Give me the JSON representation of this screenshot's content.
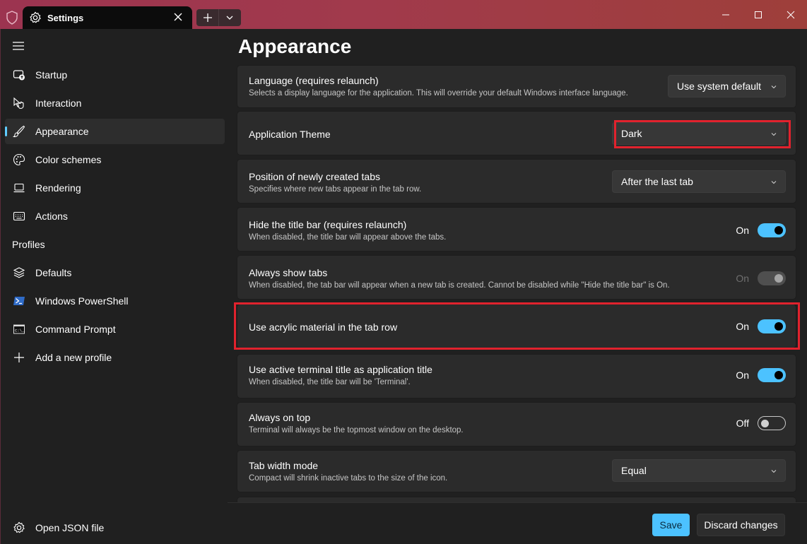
{
  "titlebar": {
    "tab_label": "Settings",
    "tab_icon": "gear-icon",
    "new_tab_icon": "plus-icon",
    "tab_menu_icon": "chevron-down-icon",
    "window_controls": [
      "minimize",
      "maximize",
      "close"
    ],
    "accent_color": "#a13a4c"
  },
  "sidebar": {
    "menu_icon": "hamburger-icon",
    "items": [
      {
        "label": "Startup",
        "icon": "startup-icon",
        "active": false
      },
      {
        "label": "Interaction",
        "icon": "interaction-icon",
        "active": false
      },
      {
        "label": "Appearance",
        "icon": "brush-icon",
        "active": true
      },
      {
        "label": "Color schemes",
        "icon": "palette-icon",
        "active": false
      },
      {
        "label": "Rendering",
        "icon": "laptop-icon",
        "active": false
      },
      {
        "label": "Actions",
        "icon": "keyboard-icon",
        "active": false
      }
    ],
    "profiles_header": "Profiles",
    "profiles": [
      {
        "label": "Defaults",
        "icon": "layers-icon"
      },
      {
        "label": "Windows PowerShell",
        "icon": "powershell-icon"
      },
      {
        "label": "Command Prompt",
        "icon": "cmd-icon"
      },
      {
        "label": "Add a new profile",
        "icon": "plus-icon"
      }
    ],
    "open_json": "Open JSON file"
  },
  "main": {
    "title": "Appearance",
    "settings": [
      {
        "title": "Language (requires relaunch)",
        "description": "Selects a display language for the application. This will override your default Windows interface language.",
        "control": "dropdown",
        "value": "Use system default"
      },
      {
        "title": "Application Theme",
        "description": "",
        "control": "dropdown",
        "value": "Dark",
        "highlighted": true
      },
      {
        "title": "Position of newly created tabs",
        "description": "Specifies where new tabs appear in the tab row.",
        "control": "dropdown",
        "value": "After the last tab"
      },
      {
        "title": "Hide the title bar (requires relaunch)",
        "description": "When disabled, the title bar will appear above the tabs.",
        "control": "toggle",
        "value": "On",
        "state": "on"
      },
      {
        "title": "Always show tabs",
        "description": "When disabled, the tab bar will appear when a new tab is created. Cannot be disabled while \"Hide the title bar\" is On.",
        "control": "toggle",
        "value": "On",
        "state": "disabled"
      },
      {
        "title": "Use acrylic material in the tab row",
        "description": "",
        "control": "toggle",
        "value": "On",
        "state": "on",
        "highlighted": true
      },
      {
        "title": "Use active terminal title as application title",
        "description": "When disabled, the title bar will be 'Terminal'.",
        "control": "toggle",
        "value": "On",
        "state": "on"
      },
      {
        "title": "Always on top",
        "description": "Terminal will always be the topmost window on the desktop.",
        "control": "toggle",
        "value": "Off",
        "state": "off"
      },
      {
        "title": "Tab width mode",
        "description": "Compact will shrink inactive tabs to the size of the icon.",
        "control": "dropdown",
        "value": "Equal"
      }
    ]
  },
  "footer": {
    "save": "Save",
    "discard": "Discard changes",
    "accent": "#4cc2ff"
  }
}
